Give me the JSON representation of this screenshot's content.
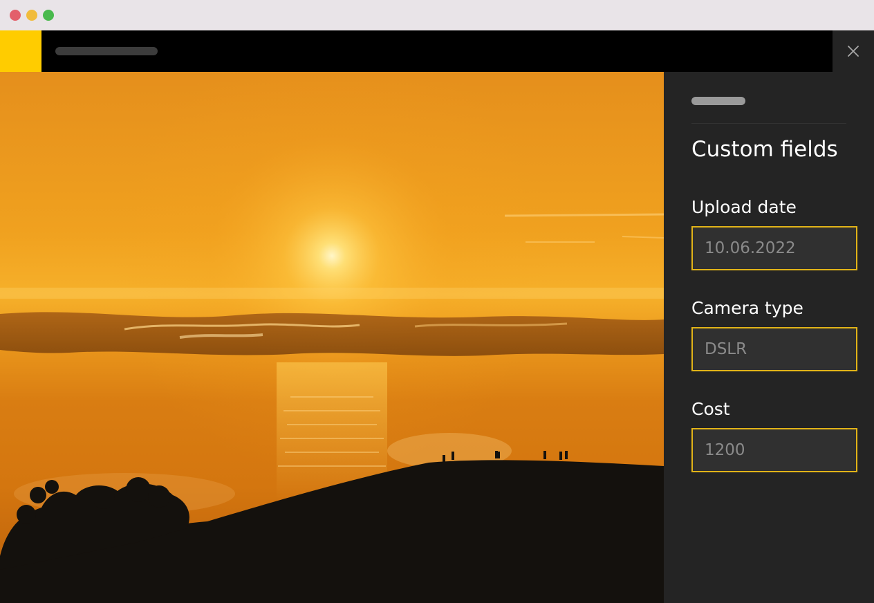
{
  "colors": {
    "brand_yellow": "#ffcc00",
    "input_border": "#e2b418",
    "panel_bg": "#242424",
    "topbar_bg": "#000000"
  },
  "window": {
    "controls": [
      "close",
      "minimize",
      "maximize"
    ]
  },
  "header": {
    "close_icon": "close-icon"
  },
  "panel": {
    "heading": "Custom fields",
    "fields": [
      {
        "label": "Upload date",
        "value": "10.06.2022"
      },
      {
        "label": "Camera type",
        "value": "DSLR"
      },
      {
        "label": "Cost",
        "value": "1200"
      }
    ]
  }
}
